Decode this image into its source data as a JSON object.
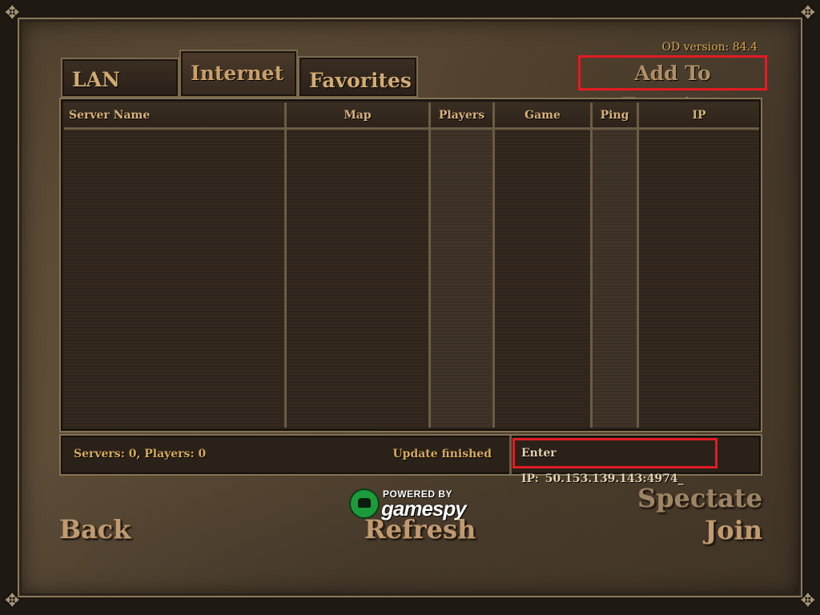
{
  "version_label": "OD version: 84.4",
  "tabs": [
    {
      "label": "LAN"
    },
    {
      "label": "Internet"
    },
    {
      "label": "Favorites"
    }
  ],
  "add_to_favorites": "Add To Favorites",
  "table": {
    "columns": [
      "Server Name",
      "Map",
      "Players",
      "Game",
      "Ping",
      "IP"
    ],
    "rows": []
  },
  "status": {
    "servers": "Servers: 0, Players: 0",
    "update": "Update finished",
    "ip_label": "Enter IP:",
    "ip_value": "50.153.139.143:4974_"
  },
  "branding": {
    "powered_by": "POWERED BY",
    "name": "gamespy",
    "logo_color": "#1c9b3a"
  },
  "buttons": {
    "back": "Back",
    "refresh": "Refresh",
    "spectate": "Spectate",
    "join": "Join"
  },
  "highlight_color": "#e21b23"
}
